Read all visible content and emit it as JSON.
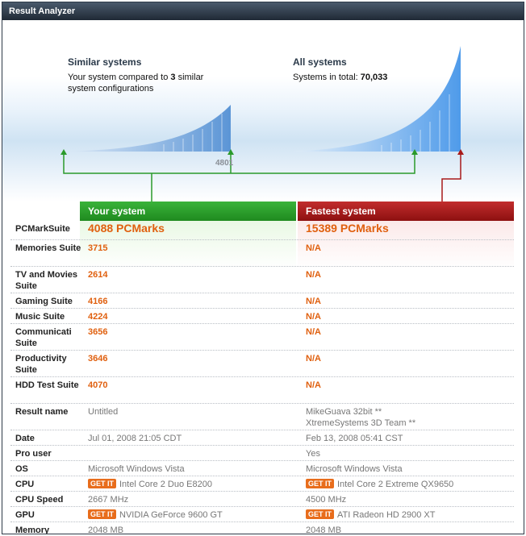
{
  "window": {
    "title": "Result Analyzer"
  },
  "similar": {
    "heading": "Similar systems",
    "line1_pre": "Your system compared to ",
    "line1_count": "3",
    "line1_post": " similar",
    "line2": "system configurations",
    "marker_value": "4801"
  },
  "all": {
    "heading": "All systems",
    "total_label": "Systems in total: ",
    "total_value": "70,033"
  },
  "columns": {
    "you": "Your system",
    "fastest": "Fastest system"
  },
  "get_it_label": "GET IT",
  "rows": [
    {
      "label": "PCMarkSuite",
      "you": "4088 PCMarks",
      "fastest": "15389 PCMarks"
    },
    {
      "label": "Memories Suite",
      "you": "3715",
      "fastest": "N/A"
    },
    {
      "label": "TV and Movies Suite",
      "you": "2614",
      "fastest": "N/A"
    },
    {
      "label": "Gaming Suite",
      "you": "4166",
      "fastest": "N/A"
    },
    {
      "label": "Music Suite",
      "you": "4224",
      "fastest": "N/A"
    },
    {
      "label": "Communicati Suite",
      "you": "3656",
      "fastest": "N/A"
    },
    {
      "label": "Productivity Suite",
      "you": "3646",
      "fastest": "N/A"
    },
    {
      "label": "HDD Test Suite",
      "you": "4070",
      "fastest": "N/A"
    },
    {
      "label": "Result name",
      "you": "Untitled",
      "fastest_line1": "MikeGuava 32bit **",
      "fastest_line2": "XtremeSystems 3D Team **"
    },
    {
      "label": "Date",
      "you": "Jul 01, 2008 21:05 CDT",
      "fastest": "Feb 13, 2008 05:41 CST"
    },
    {
      "label": "Pro user",
      "you": "",
      "fastest": "Yes"
    },
    {
      "label": "OS",
      "you": "Microsoft Windows Vista",
      "fastest": "Microsoft Windows Vista"
    },
    {
      "label": "CPU",
      "you": "Intel Core 2 Duo E8200",
      "fastest": "Intel Core 2 Extreme QX9650"
    },
    {
      "label": "CPU Speed",
      "you": "2667 MHz",
      "fastest": "4500 MHz"
    },
    {
      "label": "GPU",
      "you": "NVIDIA GeForce 9600 GT",
      "fastest": "ATI Radeon HD 2900 XT"
    },
    {
      "label": "Memory",
      "you": "2048 MB",
      "fastest": "2048 MB"
    }
  ]
}
